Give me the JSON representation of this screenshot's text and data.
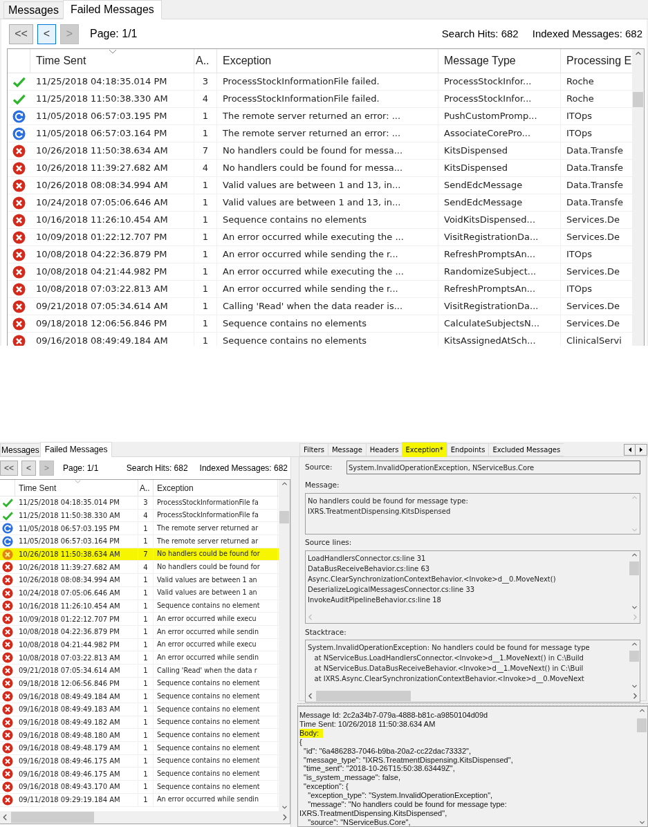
{
  "top_panel": {
    "tabs": [
      {
        "label": "Messages",
        "selected": false
      },
      {
        "label": "Failed Messages",
        "selected": true
      }
    ],
    "pager": [
      {
        "label": "<<",
        "focused": false,
        "disabled": false
      },
      {
        "label": "<",
        "focused": true,
        "disabled": false
      },
      {
        "label": ">",
        "focused": false,
        "disabled": true
      }
    ],
    "page": "Page: 1/1",
    "search_hits": "Search Hits: 682",
    "indexed_messages": "Indexed Messages: 682",
    "table": {
      "columns": [
        "Time Sent",
        "A..",
        "Exception",
        "Message Type",
        "Processing E"
      ],
      "rows": [
        {
          "kind": "success",
          "time_sent": "11/25/2018 04:18:35.014 PM",
          "attempts": "3",
          "exception": "ProcessStockInformationFile failed.",
          "message_type": "ProcessStockInfor...",
          "endpoint": "Roche"
        },
        {
          "kind": "success",
          "time_sent": "11/25/2018 11:50:38.330 AM",
          "attempts": "4",
          "exception": "ProcessStockInformationFile failed.",
          "message_type": "ProcessStockInfor...",
          "endpoint": "Roche"
        },
        {
          "kind": "retry",
          "time_sent": "11/05/2018 06:57:03.195 PM",
          "attempts": "1",
          "exception": "The remote server returned an error: ...",
          "message_type": "PushCustomPromp...",
          "endpoint": "ITOps"
        },
        {
          "kind": "retry",
          "time_sent": "11/05/2018 06:57:03.164 PM",
          "attempts": "1",
          "exception": "The remote server returned an error: ...",
          "message_type": "AssociateCorePro...",
          "endpoint": "ITOps"
        },
        {
          "kind": "error",
          "time_sent": "10/26/2018 11:50:38.634 AM",
          "attempts": "7",
          "exception": "No handlers could be found for messa...",
          "message_type": "KitsDispensed",
          "endpoint": "Data.Transfe"
        },
        {
          "kind": "error",
          "time_sent": "10/26/2018 11:39:27.682 AM",
          "attempts": "4",
          "exception": "No handlers could be found for messa...",
          "message_type": "KitsDispensed",
          "endpoint": "Data.Transfe"
        },
        {
          "kind": "error",
          "time_sent": "10/26/2018 08:08:34.994 AM",
          "attempts": "1",
          "exception": "Valid values are between 1 and 13, in...",
          "message_type": "SendEdcMessage",
          "endpoint": "Data.Transfe"
        },
        {
          "kind": "error",
          "time_sent": "10/24/2018 07:05:06.646 AM",
          "attempts": "1",
          "exception": "Valid values are between 1 and 13, in...",
          "message_type": "SendEdcMessage",
          "endpoint": "Data.Transfe"
        },
        {
          "kind": "error",
          "time_sent": "10/16/2018 11:26:10.454 AM",
          "attempts": "1",
          "exception": "Sequence contains no elements",
          "message_type": "VoidKitsDispensed...",
          "endpoint": "Services.De"
        },
        {
          "kind": "error",
          "time_sent": "10/09/2018 01:22:12.707 PM",
          "attempts": "1",
          "exception": "An error occurred while executing the ...",
          "message_type": "VisitRegistrationDa...",
          "endpoint": "Services.De"
        },
        {
          "kind": "error",
          "time_sent": "10/08/2018 04:22:36.879 PM",
          "attempts": "1",
          "exception": "An error occurred while sending the r...",
          "message_type": "RefreshPromptsAn...",
          "endpoint": "ITOps"
        },
        {
          "kind": "error",
          "time_sent": "10/08/2018 04:21:44.982 PM",
          "attempts": "1",
          "exception": "An error occurred while executing the ...",
          "message_type": "RandomizeSubject...",
          "endpoint": "Services.De"
        },
        {
          "kind": "error",
          "time_sent": "10/08/2018 07:03:22.813 AM",
          "attempts": "1",
          "exception": "An error occurred while sending the r...",
          "message_type": "RefreshPromptsAn...",
          "endpoint": "ITOps"
        },
        {
          "kind": "error",
          "time_sent": "09/21/2018 07:05:34.614 AM",
          "attempts": "1",
          "exception": "Calling 'Read' when the data reader is...",
          "message_type": "VisitRegistrationDa...",
          "endpoint": "Services.De"
        },
        {
          "kind": "error",
          "time_sent": "09/18/2018 12:06:56.846 PM",
          "attempts": "1",
          "exception": "Sequence contains no elements",
          "message_type": "CalculateSubjectsN...",
          "endpoint": "Services.De"
        },
        {
          "kind": "error",
          "time_sent": "09/16/2018 08:49:49.184 AM",
          "attempts": "1",
          "exception": "Sequence contains no elements",
          "message_type": "KitsAssignedAtSch...",
          "endpoint": "ClinicalServi"
        }
      ]
    }
  },
  "list_panel": {
    "tabs": [
      {
        "label": "Messages",
        "selected": false
      },
      {
        "label": "Failed Messages",
        "selected": true
      }
    ],
    "pager": [
      {
        "label": "<<",
        "focused": false,
        "disabled": false
      },
      {
        "label": "<",
        "focused": false,
        "disabled": false
      },
      {
        "label": ">",
        "focused": false,
        "disabled": true
      }
    ],
    "page": "Page: 1/1",
    "search_hits": "Search Hits: 682",
    "indexed_messages": "Indexed Messages: 682",
    "table": {
      "columns": [
        "Time Sent",
        "A..",
        "Exception"
      ],
      "rows": [
        {
          "kind": "success",
          "time_sent": "11/25/2018 04:18:35.014 PM",
          "attempts": "3",
          "exception": "ProcessStockInformationFile fa",
          "highlighted": false
        },
        {
          "kind": "success",
          "time_sent": "11/25/2018 11:50:38.330 AM",
          "attempts": "4",
          "exception": "ProcessStockInformationFile fa",
          "highlighted": false
        },
        {
          "kind": "retry",
          "time_sent": "11/05/2018 06:57:03.195 PM",
          "attempts": "1",
          "exception": "The remote server returned ar",
          "highlighted": false
        },
        {
          "kind": "retry",
          "time_sent": "11/05/2018 06:57:03.164 PM",
          "attempts": "1",
          "exception": "The remote server returned ar",
          "highlighted": false
        },
        {
          "kind": "error",
          "time_sent": "10/26/2018 11:50:38.634 AM",
          "attempts": "7",
          "exception": "No handlers could be found for",
          "highlighted": true
        },
        {
          "kind": "error",
          "time_sent": "10/26/2018 11:39:27.682 AM",
          "attempts": "4",
          "exception": "No handlers could be found for",
          "highlighted": false
        },
        {
          "kind": "error",
          "time_sent": "10/26/2018 08:08:34.994 AM",
          "attempts": "1",
          "exception": "Valid values are between 1 an",
          "highlighted": false
        },
        {
          "kind": "error",
          "time_sent": "10/24/2018 07:05:06.646 AM",
          "attempts": "1",
          "exception": "Valid values are between 1 an",
          "highlighted": false
        },
        {
          "kind": "error",
          "time_sent": "10/16/2018 11:26:10.454 AM",
          "attempts": "1",
          "exception": "Sequence contains no element",
          "highlighted": false
        },
        {
          "kind": "error",
          "time_sent": "10/09/2018 01:22:12.707 PM",
          "attempts": "1",
          "exception": "An error occurred while execu",
          "highlighted": false
        },
        {
          "kind": "error",
          "time_sent": "10/08/2018 04:22:36.879 PM",
          "attempts": "1",
          "exception": "An error occurred while sendin",
          "highlighted": false
        },
        {
          "kind": "error",
          "time_sent": "10/08/2018 04:21:44.982 PM",
          "attempts": "1",
          "exception": "An error occurred while execu",
          "highlighted": false
        },
        {
          "kind": "error",
          "time_sent": "10/08/2018 07:03:22.813 AM",
          "attempts": "1",
          "exception": "An error occurred while sendin",
          "highlighted": false
        },
        {
          "kind": "error",
          "time_sent": "09/21/2018 07:05:34.614 AM",
          "attempts": "1",
          "exception": "Calling 'Read' when the data r",
          "highlighted": false
        },
        {
          "kind": "error",
          "time_sent": "09/18/2018 12:06:56.846 PM",
          "attempts": "1",
          "exception": "Sequence contains no element",
          "highlighted": false
        },
        {
          "kind": "error",
          "time_sent": "09/16/2018 08:49:49.184 AM",
          "attempts": "1",
          "exception": "Sequence contains no element",
          "highlighted": false
        },
        {
          "kind": "error",
          "time_sent": "09/16/2018 08:49:49.183 AM",
          "attempts": "1",
          "exception": "Sequence contains no element",
          "highlighted": false
        },
        {
          "kind": "error",
          "time_sent": "09/16/2018 08:49:49.182 AM",
          "attempts": "1",
          "exception": "Sequence contains no element",
          "highlighted": false
        },
        {
          "kind": "error",
          "time_sent": "09/16/2018 08:49:48.180 AM",
          "attempts": "1",
          "exception": "Sequence contains no element",
          "highlighted": false
        },
        {
          "kind": "error",
          "time_sent": "09/16/2018 08:49:48.179 AM",
          "attempts": "1",
          "exception": "Sequence contains no element",
          "highlighted": false
        },
        {
          "kind": "error",
          "time_sent": "09/16/2018 08:49:46.175 AM",
          "attempts": "1",
          "exception": "Sequence contains no element",
          "highlighted": false
        },
        {
          "kind": "error",
          "time_sent": "09/16/2018 08:49:46.175 AM",
          "attempts": "1",
          "exception": "Sequence contains no element",
          "highlighted": false
        },
        {
          "kind": "error",
          "time_sent": "09/16/2018 08:49:43.170 AM",
          "attempts": "1",
          "exception": "Sequence contains no element",
          "highlighted": false
        },
        {
          "kind": "error",
          "time_sent": "09/11/2018 09:29:19.184 AM",
          "attempts": "1",
          "exception": "An error occurred while sendin",
          "highlighted": false
        }
      ]
    }
  },
  "detail_panel": {
    "tabs": [
      {
        "label": "Filters",
        "selected": false,
        "highlighted": false
      },
      {
        "label": "Message",
        "selected": false,
        "highlighted": false
      },
      {
        "label": "Headers",
        "selected": false,
        "highlighted": false
      },
      {
        "label": "Exception*",
        "selected": true,
        "highlighted": true
      },
      {
        "label": "Endpoints",
        "selected": false,
        "highlighted": false
      },
      {
        "label": "Excluded Messages",
        "selected": false,
        "highlighted": false
      }
    ],
    "source_label": "Source:",
    "source": "System.InvalidOperationException, NServiceBus.Core",
    "message_label": "Message:",
    "message_lines": [
      "No handlers could be found for message type:",
      "IXRS.TreatmentDispensing.KitsDispensed"
    ],
    "source_lines_label": "Source lines:",
    "source_lines": [
      "LoadHandlersConnector.cs:line 31",
      "DataBusReceiveBehavior.cs:line 63",
      "Async.ClearSynchronizationContextBehavior.<Invoke>d__0.MoveNext()",
      "DeserializeLogicalMessagesConnector.cs:line 33",
      "InvokeAuditPipelineBehavior.cs:line 18"
    ],
    "stacktrace_label": "Stacktrace:",
    "stacktrace": [
      "System.InvalidOperationException: No handlers could be found for message type",
      "   at NServiceBus.LoadHandlersConnector.<Invoke>d__1.MoveNext() in C:\\Build",
      "   at NServiceBus.DataBusReceiveBehavior.<Invoke>d__1.MoveNext() in C:\\Buil",
      "   at IXRS.Async.ClearSynchronizationContextBehavior.<Invoke>d__0.MoveNext"
    ]
  },
  "body_panel": {
    "lines": [
      {
        "text": "Message Id: 2c2a34b7-079a-4888-b81c-a9850104d09d",
        "highlighted": false
      },
      {
        "text": "Time Sent: 10/26/2018 11:50:38.634 AM",
        "highlighted": false
      },
      {
        "text": "Body:",
        "highlighted": true
      },
      {
        "text": "{",
        "highlighted": false
      },
      {
        "text": "  \"id\": \"6a486283-7046-b9ba-20a2-cc22dac73332\",",
        "highlighted": false
      },
      {
        "text": "  \"message_type\": \"IXRS.TreatmentDispensing.KitsDispensed\",",
        "highlighted": false
      },
      {
        "text": "  \"time_sent\": \"2018-10-26T15:50:38.63449Z\",",
        "highlighted": false
      },
      {
        "text": "  \"is_system_message\": false,",
        "highlighted": false
      },
      {
        "text": "  \"exception\": {",
        "highlighted": false
      },
      {
        "text": "    \"exception_type\": \"System.InvalidOperationException\",",
        "highlighted": false
      },
      {
        "text": "    \"message\": \"No handlers could be found for message type:",
        "highlighted": false
      },
      {
        "text": "IXRS.TreatmentDispensing.KitsDispensed\",",
        "highlighted": false
      },
      {
        "text": "    \"source\": \"NServiceBus.Core\",",
        "highlighted": false
      }
    ]
  }
}
